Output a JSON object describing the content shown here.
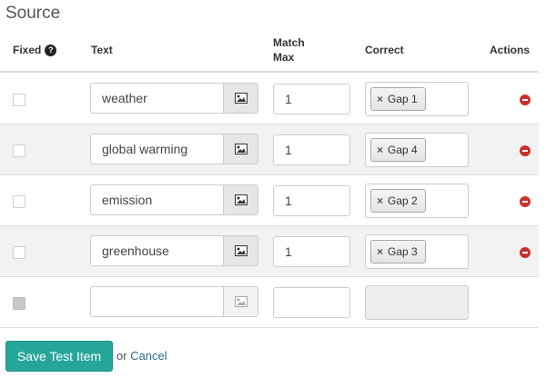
{
  "section": {
    "title": "Source"
  },
  "columns": {
    "fixed": "Fixed",
    "help_icon": "?",
    "text": "Text",
    "match_max_line1": "Match",
    "match_max_line2": "Max",
    "correct": "Correct",
    "actions": "Actions"
  },
  "rows": [
    {
      "text": "weather",
      "match_max": "1",
      "correct_tag": "Gap 1",
      "tag_remove_glyph": "×"
    },
    {
      "text": "global warming",
      "match_max": "1",
      "correct_tag": "Gap 4",
      "tag_remove_glyph": "×"
    },
    {
      "text": "emission",
      "match_max": "1",
      "correct_tag": "Gap 2",
      "tag_remove_glyph": "×"
    },
    {
      "text": "greenhouse",
      "match_max": "1",
      "correct_tag": "Gap 3",
      "tag_remove_glyph": "×"
    }
  ],
  "new_row": {
    "text": "",
    "match_max": ""
  },
  "footer": {
    "save_label": "Save Test Item",
    "or_label": "or",
    "cancel_label": "Cancel"
  },
  "colors": {
    "save_button": "#26a69a",
    "remove_icon": "#c9302c",
    "row_stripe": "#f2f2f2"
  },
  "icons": {
    "help": "question-circle-icon",
    "image": "image-icon",
    "tag_remove": "close-icon",
    "row_remove": "minus-circle-icon"
  }
}
